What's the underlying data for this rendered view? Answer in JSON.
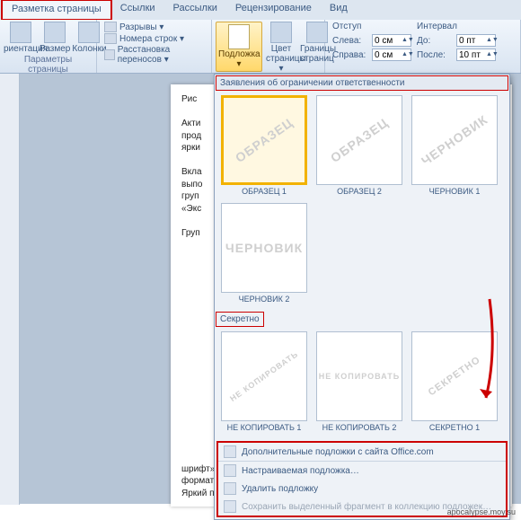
{
  "tabs": {
    "active": "Разметка страницы",
    "items": [
      "Разметка страницы",
      "Ссылки",
      "Рассылки",
      "Рецензирование",
      "Вид"
    ]
  },
  "ribbon": {
    "group1": {
      "label": "Параметры страницы",
      "orientation": "риентация",
      "size": "Размер",
      "columns": "Колонки",
      "breaks": "Разрывы ▾",
      "lineNumbers": "Номера строк ▾",
      "hyphenation": "Расстановка переносов ▾"
    },
    "watermarkBtn": "Подложка ▾",
    "pageColor": "Цвет страницы ▾",
    "pageBorders": "Границы страниц",
    "indent": {
      "label": "Отступ",
      "leftKey": "Слева:",
      "leftVal": "0 см",
      "rightKey": "Справа:",
      "rightVal": "0 см"
    },
    "spacing": {
      "label": "Интервал",
      "beforeKey": "До:",
      "beforeVal": "0 пт",
      "afterKey": "После:",
      "afterVal": "10 пт"
    }
  },
  "gallery": {
    "section1": "Заявления об ограничении ответственности",
    "section2": "Секретно",
    "thumbs1": [
      {
        "wm": "ОБРАЗЕЦ",
        "cap": "ОБРАЗЕЦ 1",
        "sel": true
      },
      {
        "wm": "ОБРАЗЕЦ",
        "cap": "ОБРАЗЕЦ 2",
        "sel": false
      },
      {
        "wm": "ЧЕРНОВИК",
        "cap": "ЧЕРНОВИК 1",
        "sel": false
      },
      {
        "wm": "ЧЕРНОВИК",
        "cap": "ЧЕРНОВИК 2",
        "sel": false
      }
    ],
    "thumbs2": [
      {
        "wm": "НЕ КОПИРОВАТЬ",
        "cap": "НЕ КОПИРОВАТЬ 1"
      },
      {
        "wm": "НЕ КОПИРОВАТЬ",
        "cap": "НЕ КОПИРОВАТЬ 2"
      },
      {
        "wm": "СЕКРЕТНО",
        "cap": "СЕКРЕТНО 1"
      }
    ],
    "footer": {
      "more": "Дополнительные подложки с сайта Office.com",
      "custom": "Настраиваемая подложка…",
      "remove": "Удалить подложку",
      "save": "Сохранить выделенный фрагмент в коллекцию подложек…"
    }
  },
  "docText": {
    "l1": "Рис",
    "l2": "Акти",
    "l3": "прод",
    "l4": "ярки",
    "l5": "Вкла",
    "l6": "выпо",
    "l7": "груп",
    "l8": "«Экс",
    "l9": "Груп",
    "tail1": "шрифт» и «курсив» поскольку в данном случае они относятся к форматированию текста, в частности",
    "tail2": "Яркий пример этого – вкладка «Шрифт» с набором команд"
  },
  "status": "apocalypse.moy.su"
}
